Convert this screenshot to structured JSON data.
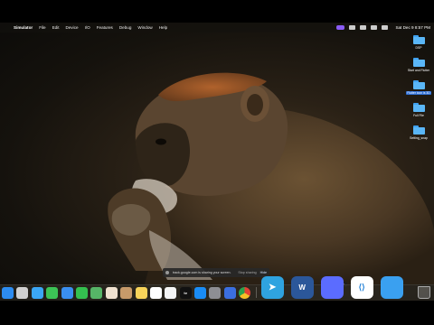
{
  "menubar": {
    "app_name": "Simulator",
    "items": [
      "File",
      "Edit",
      "Device",
      "I/O",
      "Features",
      "Debug",
      "Window",
      "Help"
    ],
    "clock": "Sat Dec 9  8:57 PM"
  },
  "desktop_items": [
    {
      "label": "DSP",
      "icon": "folder-icon",
      "selected": false
    },
    {
      "label": "Start and Flutter",
      "icon": "folder-icon",
      "selected": false
    },
    {
      "label": "Flutter icon is 3D",
      "icon": "folder-icon",
      "selected": true
    },
    {
      "label": "Full File",
      "icon": "folder-icon",
      "selected": false
    },
    {
      "label": "Setting_snap",
      "icon": "folder-icon",
      "selected": false
    }
  ],
  "banner": {
    "text": "track.google.com is sharing your screen.",
    "stop_label": "Stop sharing",
    "hide_label": "Hide"
  },
  "dock": {
    "tooltip": "Preview",
    "apps": [
      {
        "name": "finder",
        "color": "#2d8cf0",
        "size": "sm",
        "text": ""
      },
      {
        "name": "launchpad",
        "color": "#d0d0d0",
        "size": "sm",
        "text": ""
      },
      {
        "name": "safari",
        "color": "#3ba6f5",
        "size": "sm",
        "text": ""
      },
      {
        "name": "messages",
        "color": "#3cc356",
        "size": "sm",
        "text": ""
      },
      {
        "name": "mail",
        "color": "#3a8ff0",
        "size": "sm",
        "text": ""
      },
      {
        "name": "facetime",
        "color": "#34c04f",
        "size": "sm",
        "text": ""
      },
      {
        "name": "maps",
        "color": "#56b567",
        "size": "sm",
        "text": ""
      },
      {
        "name": "photos",
        "color": "#f0e2d0",
        "size": "sm",
        "text": ""
      },
      {
        "name": "contacts",
        "color": "#c79a6a",
        "size": "sm",
        "text": ""
      },
      {
        "name": "notes",
        "color": "#f7d35a",
        "size": "sm",
        "text": ""
      },
      {
        "name": "reminders",
        "color": "#ffffff",
        "size": "sm",
        "text": ""
      },
      {
        "name": "freeform",
        "color": "#f5f5f5",
        "size": "sm",
        "text": ""
      },
      {
        "name": "tv",
        "color": "#111111",
        "size": "sm",
        "text": "tv"
      },
      {
        "name": "app-store",
        "color": "#1a8cf5",
        "size": "sm",
        "text": ""
      },
      {
        "name": "system-settings",
        "color": "#8e8e93",
        "size": "sm",
        "text": ""
      },
      {
        "name": "xcode",
        "color": "#3b6fe0",
        "size": "sm",
        "text": ""
      },
      {
        "name": "chrome",
        "color": "#ffffff",
        "size": "sm",
        "text": ""
      },
      {
        "name": "telegram",
        "color": "#2fa3e0",
        "size": "lg",
        "text": ""
      },
      {
        "name": "word",
        "color": "#2b579a",
        "size": "lg",
        "text": "W"
      },
      {
        "name": "simulator",
        "color": "#5b6cff",
        "size": "lg",
        "text": ""
      },
      {
        "name": "vscode",
        "color": "#ffffff",
        "size": "lg",
        "text": ""
      },
      {
        "name": "finder-window",
        "color": "#3aa0f0",
        "size": "lg",
        "text": ""
      }
    ]
  }
}
